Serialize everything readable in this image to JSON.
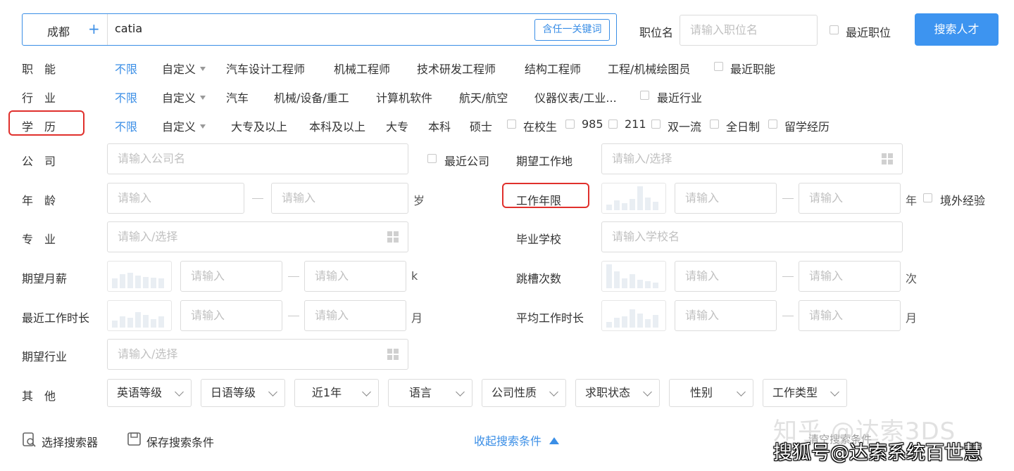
{
  "search": {
    "city": "成都",
    "city_add": "+",
    "keyword_value": "catia",
    "any_keyword_label": "含任一关键词",
    "position_label": "职位名",
    "position_placeholder": "请输入职位名",
    "recent_position_label": "最近职位",
    "search_button": "搜索人才"
  },
  "function_row": {
    "label": "职　能",
    "unlimited": "不限",
    "custom": "自定义",
    "options": [
      "汽车设计工程师",
      "机械工程师",
      "技术研发工程师",
      "结构工程师",
      "工程/机械绘图员"
    ],
    "recent_label": "最近职能"
  },
  "industry_row": {
    "label": "行　业",
    "unlimited": "不限",
    "custom": "自定义",
    "options": [
      "汽车",
      "机械/设备/重工",
      "计算机软件",
      "航天/航空",
      "仪器仪表/工业..."
    ],
    "recent_label": "最近行业"
  },
  "education_row": {
    "label": "学　历",
    "unlimited": "不限",
    "custom": "自定义",
    "options": [
      "大专及以上",
      "本科及以上",
      "大专",
      "本科",
      "硕士"
    ],
    "checkboxes": [
      "在校生",
      "985",
      "211",
      "双一流",
      "全日制",
      "留学经历"
    ]
  },
  "company_row": {
    "label": "公　司",
    "placeholder": "请输入公司名",
    "recent_label": "最近公司",
    "expect_location_label": "期望工作地",
    "expect_location_placeholder": "请输入/选择"
  },
  "age_row": {
    "label": "年　龄",
    "min_placeholder": "请输入",
    "max_placeholder": "请输入",
    "unit": "岁",
    "work_years_label": "工作年限",
    "work_min_placeholder": "请输入",
    "work_max_placeholder": "请输入",
    "work_unit": "年",
    "overseas_label": "境外经验"
  },
  "major_row": {
    "label": "专　业",
    "placeholder": "请输入/选择",
    "school_label": "毕业学校",
    "school_placeholder": "请输入学校名"
  },
  "salary_row": {
    "label": "期望月薪",
    "min_placeholder": "请输入",
    "max_placeholder": "请输入",
    "unit": "k",
    "jobhop_label": "跳槽次数",
    "jobhop_min_placeholder": "请输入",
    "jobhop_max_placeholder": "请输入",
    "jobhop_unit": "次"
  },
  "recent_duration_row": {
    "label": "最近工作时长",
    "min_placeholder": "请输入",
    "max_placeholder": "请输入",
    "unit": "月",
    "avg_label": "平均工作时长",
    "avg_min_placeholder": "请输入",
    "avg_max_placeholder": "请输入",
    "avg_unit": "月"
  },
  "expect_industry_row": {
    "label": "期望行业",
    "placeholder": "请输入/选择"
  },
  "other_row": {
    "label": "其　他",
    "selects": [
      "英语等级",
      "日语等级",
      "近1年",
      "语言",
      "公司性质",
      "求职状态",
      "性别",
      "工作类型"
    ]
  },
  "footer": {
    "select_searcher": "选择搜索器",
    "save_conditions": "保存搜索条件",
    "collapse": "收起搜索条件",
    "clear_conditions": "清空搜索条件"
  },
  "watermark": {
    "line1": "知乎 @达索3DS",
    "line2": "搜狐号@达索系统百世慧"
  },
  "colors": {
    "accent": "#3a8ee6",
    "search_button": "#3d94f0",
    "highlight_box": "#e0302c"
  }
}
